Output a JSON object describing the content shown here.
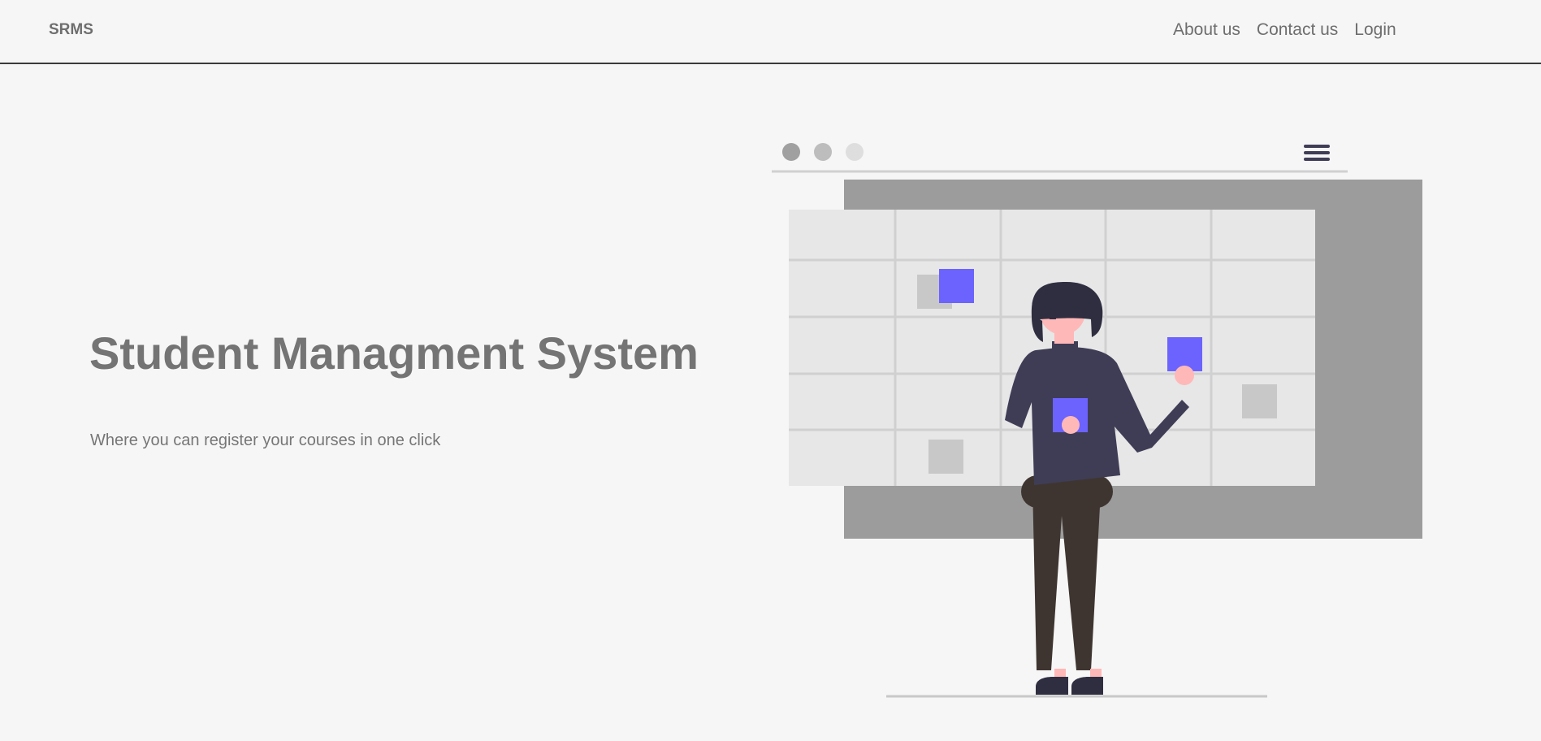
{
  "navbar": {
    "brand": "SRMS",
    "links": [
      {
        "label": "About us"
      },
      {
        "label": "Contact us"
      },
      {
        "label": "Login"
      }
    ]
  },
  "hero": {
    "title": "Student Managment System",
    "subtitle": "Where you can register your courses in one click"
  },
  "colors": {
    "background": "#f6f6f6",
    "text": "#747474",
    "accent": "#6c63ff",
    "navbar_border": "#3a3a3a"
  },
  "illustration": {
    "icon": "calendar-board-person-illustration"
  }
}
